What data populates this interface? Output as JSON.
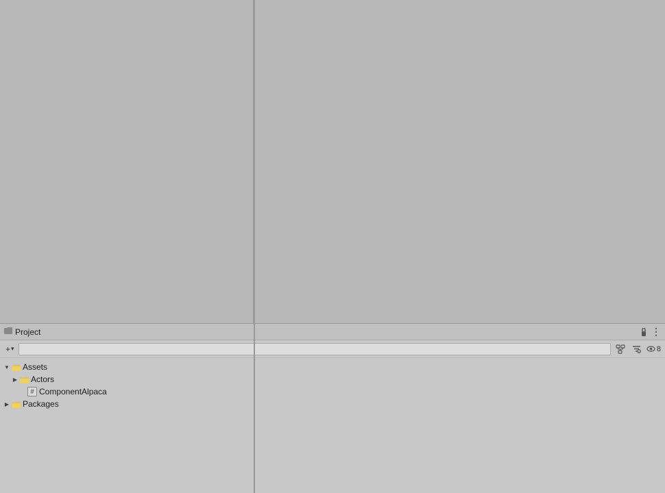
{
  "layout": {
    "leftPanelWidth": 370,
    "projectPanelHeight": 248
  },
  "projectPanel": {
    "title": "Project",
    "lockIcon": "🔒",
    "menuIcon": "⋮",
    "addButton": "+",
    "addDropdown": "▾",
    "searchPlaceholder": "",
    "eyeCount": "8",
    "toolbar": {
      "addLabel": "+",
      "dropdownLabel": "▾",
      "eyeLabel": "8"
    }
  },
  "tree": {
    "items": [
      {
        "id": "assets",
        "label": "Assets",
        "type": "folder",
        "indent": 0,
        "expanded": true,
        "hasArrow": true,
        "arrowState": "expanded"
      },
      {
        "id": "actors",
        "label": "Actors",
        "type": "folder",
        "indent": 1,
        "expanded": false,
        "hasArrow": true,
        "arrowState": "collapsed"
      },
      {
        "id": "componentalpaca",
        "label": "ComponentAlpaca",
        "type": "file",
        "indent": 2,
        "hasArrow": false,
        "fileSymbol": "#"
      },
      {
        "id": "packages",
        "label": "Packages",
        "type": "folder",
        "indent": 0,
        "expanded": false,
        "hasArrow": true,
        "arrowState": "collapsed"
      }
    ]
  }
}
